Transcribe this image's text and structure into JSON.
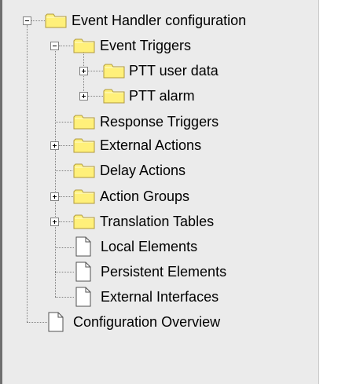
{
  "tree": {
    "root": {
      "label": "Event Handler configuration",
      "icon": "folder-icon",
      "expanded": true
    },
    "event_triggers": {
      "label": "Event Triggers",
      "icon": "folder-icon",
      "expanded": true
    },
    "ptt_user_data": {
      "label": "PTT user data",
      "icon": "folder-icon",
      "expanded": false
    },
    "ptt_alarm": {
      "label": "PTT alarm",
      "icon": "folder-icon",
      "expanded": false
    },
    "response_triggers": {
      "label": "Response Triggers",
      "icon": "folder-icon"
    },
    "external_actions": {
      "label": "External Actions",
      "icon": "folder-icon",
      "expanded": false
    },
    "delay_actions": {
      "label": "Delay Actions",
      "icon": "folder-icon"
    },
    "action_groups": {
      "label": "Action Groups",
      "icon": "folder-icon",
      "expanded": false
    },
    "translation_tables": {
      "label": "Translation Tables",
      "icon": "folder-icon",
      "expanded": false
    },
    "local_elements": {
      "label": "Local Elements",
      "icon": "document-icon"
    },
    "persistent_elements": {
      "label": "Persistent Elements",
      "icon": "document-icon"
    },
    "external_interfaces": {
      "label": "External Interfaces",
      "icon": "document-icon"
    },
    "configuration_overview": {
      "label": "Configuration Overview",
      "icon": "document-icon"
    }
  },
  "colors": {
    "panel_background": "#ebebeb",
    "folder_fill": "#fff07a",
    "folder_outline": "#b09a3c",
    "guide_line": "#808080"
  }
}
